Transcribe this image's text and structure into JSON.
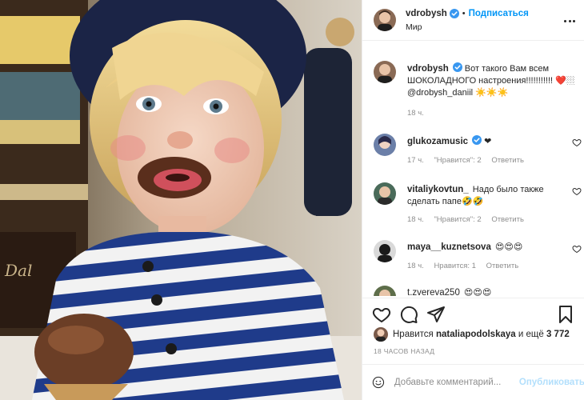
{
  "post": {
    "author": "vdrobysh",
    "follow_label": "Подписаться",
    "separator": "•",
    "location": "Мир"
  },
  "comments": [
    {
      "user": "vdrobysh",
      "text": "Вот такого Вам всем ШОКОЛАДНОГО настроения!!!!!!!!!!! ❤️🏼 @drobysh_daniil ☀️☀️☀️",
      "time": "18 ч."
    },
    {
      "user": "glukozamusic",
      "text": "❤",
      "time": "17 ч.",
      "likes": "\"Нравится\": 2",
      "reply": "Ответить"
    },
    {
      "user": "vitaliykovtun_",
      "text": "Надо было также сделать папе🤣🤣",
      "time": "18 ч.",
      "likes": "\"Нравится\": 2",
      "reply": "Ответить"
    },
    {
      "user": "maya__kuznetsova",
      "text": "😍😍😍",
      "time": "18 ч.",
      "likes": "Нравится: 1",
      "reply": "Ответить"
    },
    {
      "user": "t.zvereva250",
      "text": "😍😍😍"
    }
  ],
  "likes": {
    "prefix": "Нравится",
    "user": "nataliapodolskaya",
    "suffix": "и ещё",
    "count": "3 772"
  },
  "time_ago": "18 ЧАСОВ НАЗАД",
  "add_comment": {
    "placeholder": "Добавьте комментарий...",
    "publish": "Опубликовать"
  },
  "icons": {
    "verified": "verified-badge-icon",
    "more": "more-options-icon",
    "like": "heart-icon",
    "comment": "comment-icon",
    "share": "paper-plane-icon",
    "save": "bookmark-icon",
    "emoji": "smiley-icon"
  },
  "colors": {
    "accent": "#0095f6",
    "muted": "#8e8e8e",
    "text": "#262626",
    "publish_disabled": "#b2dffc"
  }
}
